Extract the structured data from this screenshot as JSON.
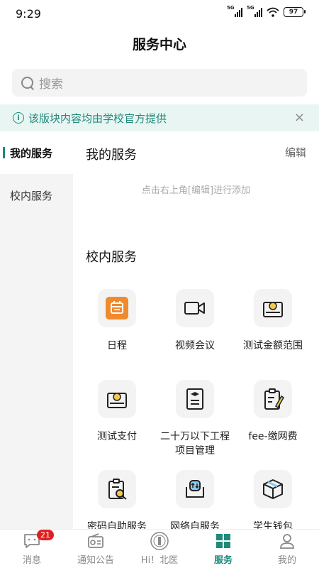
{
  "status": {
    "time": "9:29",
    "network1": "5G",
    "network2": "5G",
    "battery": "97"
  },
  "header": {
    "title": "服务中心"
  },
  "search": {
    "placeholder": "搜索"
  },
  "notice": {
    "text": "该版块内容均由学校官方提供",
    "close": "×"
  },
  "sidebar": {
    "items": [
      {
        "label": "我的服务"
      },
      {
        "label": "校内服务"
      }
    ]
  },
  "my_services": {
    "title": "我的服务",
    "edit": "编辑",
    "hint": "点击右上角[编辑]进行添加"
  },
  "campus": {
    "title": "校内服务",
    "items": [
      {
        "label": "日程",
        "icon": "calendar-icon"
      },
      {
        "label": "视频会议",
        "icon": "video-camera-icon"
      },
      {
        "label": "测试金额范围",
        "icon": "payment-icon"
      },
      {
        "label": "测试支付",
        "icon": "payment-icon"
      },
      {
        "label": "二十万以下工程项目管理",
        "icon": "document-icon"
      },
      {
        "label": "fee-缴网费",
        "icon": "clipboard-edit-icon"
      },
      {
        "label": "密码自助服务",
        "icon": "password-icon"
      },
      {
        "label": "网络自服务",
        "icon": "network-icon"
      },
      {
        "label": "学生钱包",
        "icon": "wallet-icon"
      }
    ]
  },
  "tabs": [
    {
      "label": "消息",
      "badge": "21"
    },
    {
      "label": "通知公告"
    },
    {
      "label": "Hi！北医"
    },
    {
      "label": "服务"
    },
    {
      "label": "我的"
    }
  ],
  "colors": {
    "accent": "#1f8a7b",
    "badge": "#e02020",
    "calendar": "#f08a2c"
  }
}
